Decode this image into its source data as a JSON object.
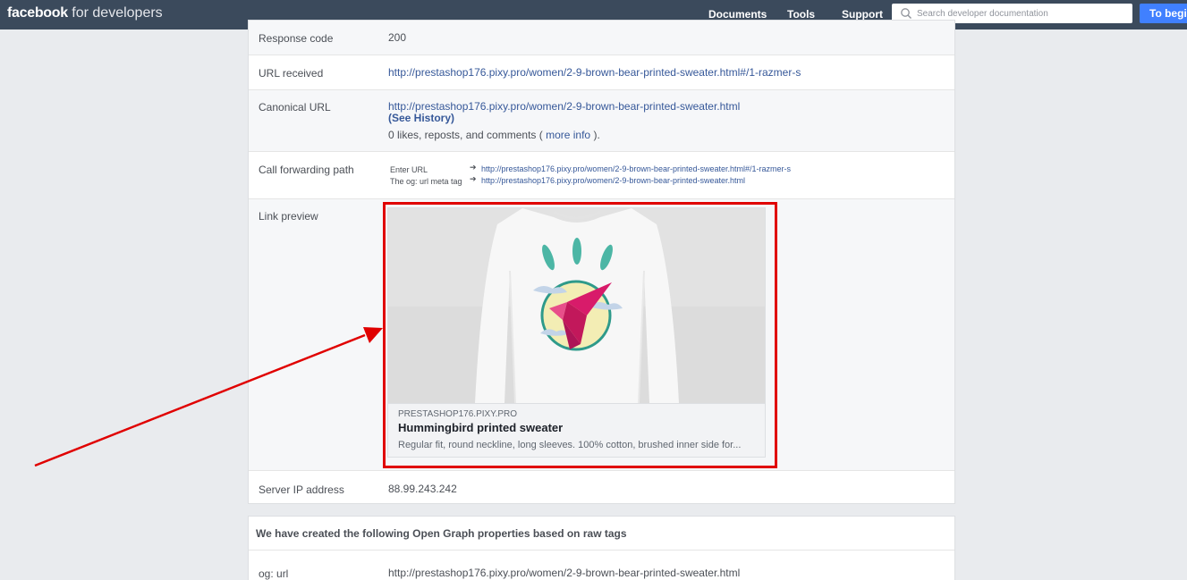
{
  "topbar": {
    "brand": "facebook",
    "brand_sub": " for developers",
    "nav": [
      "Documents",
      "Tools",
      "Support"
    ],
    "search_placeholder": "Search developer documentation",
    "begin_label": "To begin"
  },
  "results": {
    "response_code": {
      "label": "Response code",
      "value": "200"
    },
    "url_received": {
      "label": "URL received",
      "value": "http://prestashop176.pixy.pro/women/2-9-brown-bear-printed-sweater.html#/1-razmer-s"
    },
    "canonical_url": {
      "label": "Canonical URL",
      "value": "http://prestashop176.pixy.pro/women/2-9-brown-bear-printed-sweater.html",
      "history_link": "(See History)",
      "likes_prefix": "0 likes, reposts, and comments ( ",
      "more_info": "more info",
      "likes_suffix": " )."
    },
    "call_forwarding": {
      "label": "Call forwarding path",
      "steps": [
        {
          "name": "Enter URL",
          "arrow": "➔",
          "url": "http://prestashop176.pixy.pro/women/2-9-brown-bear-printed-sweater.html#/1-razmer-s"
        },
        {
          "name": "The og: url meta tag",
          "arrow": "➔",
          "url": "http://prestashop176.pixy.pro/women/2-9-brown-bear-printed-sweater.html"
        }
      ]
    },
    "link_preview": {
      "label": "Link preview",
      "domain": "PRESTASHOP176.PIXY.PRO",
      "title": "Hummingbird printed sweater",
      "description": "Regular fit, round neckline, long sleeves. 100% cotton, brushed inner side for...",
      "image_icon": "hummingbird-sweater-image"
    },
    "server_ip": {
      "label": "Server IP address",
      "value": "88.99.243.242"
    }
  },
  "og_properties": {
    "header": "We have created the following Open Graph properties based on raw tags",
    "rows": [
      {
        "label": "og: url",
        "value": "http://prestashop176.pixy.pro/women/2-9-brown-bear-printed-sweater.html"
      }
    ]
  },
  "colors": {
    "topbar": "#3b4a5c",
    "link": "#365899",
    "accent_button": "#4080ff",
    "highlight": "#e00000",
    "page_bg": "#e9ebee"
  }
}
